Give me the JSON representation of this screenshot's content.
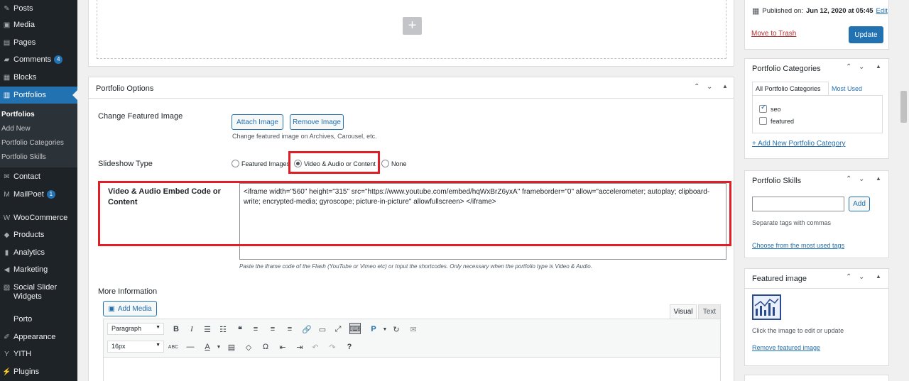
{
  "sidebar": {
    "items": [
      {
        "label": "Posts",
        "icon": "pin-icon"
      },
      {
        "label": "Media",
        "icon": "media-icon"
      },
      {
        "label": "Pages",
        "icon": "pages-icon"
      },
      {
        "label": "Comments",
        "icon": "comments-icon",
        "badge": "4"
      },
      {
        "label": "Blocks",
        "icon": "blocks-icon"
      },
      {
        "label": "Portfolios",
        "icon": "portfolio-icon"
      },
      {
        "label": "Contact",
        "icon": "mail-icon"
      },
      {
        "label": "MailPoet",
        "icon": "mailpoet-icon",
        "badge": "1"
      },
      {
        "label": "WooCommerce",
        "icon": "woo-icon"
      },
      {
        "label": "Products",
        "icon": "products-icon"
      },
      {
        "label": "Analytics",
        "icon": "analytics-icon"
      },
      {
        "label": "Marketing",
        "icon": "marketing-icon"
      },
      {
        "label": "Social Slider Widgets",
        "icon": "slider-icon"
      },
      {
        "label": "Porto",
        "icon": ""
      },
      {
        "label": "Appearance",
        "icon": "brush-icon"
      },
      {
        "label": "YITH",
        "icon": "yith-icon"
      },
      {
        "label": "Plugins",
        "icon": "plugin-icon"
      }
    ],
    "submenu": [
      "Portfolios",
      "Add New",
      "Portfolio Categories",
      "Portfolio Skills"
    ]
  },
  "portfolio_options": {
    "title": "Portfolio Options",
    "change_featured_label": "Change Featured Image",
    "attach_label": "Attach Image",
    "remove_label": "Remove Image",
    "featured_help": "Change featured image on Archives, Carousel, etc.",
    "slideshow_label": "Slideshow Type",
    "slideshow_options": [
      "Featured Images",
      "Video & Audio or Content",
      "None"
    ],
    "slideshow_selected": "Video & Audio or Content",
    "embed_label_1": "Video & Audio Embed Code or",
    "embed_label_2": "Content",
    "embed_value": "<iframe width=\"560\" height=\"315\" src=\"https://www.youtube.com/embed/hqWxBrZ6yxA\" frameborder=\"0\" allow=\"accelerometer; autoplay; clipboard-write; encrypted-media; gyroscope; picture-in-picture\" allowfullscreen> </iframe>",
    "embed_help": "Paste the iframe code of the Flash (YouTube or Vimeo etc) or Input the shortcodes. Only necessary when the portfolio type is Video & Audio.",
    "more_info_label": "More Information",
    "add_media_label": "Add Media",
    "tab_visual": "Visual",
    "tab_text": "Text",
    "format_select": "Paragraph",
    "size_select": "16px"
  },
  "publish": {
    "published_prefix": "Published on: ",
    "published_date": "Jun 12, 2020 at 05:45",
    "edit_label": "Edit",
    "trash_label": "Move to Trash",
    "update_label": "Update"
  },
  "categories": {
    "title": "Portfolio Categories",
    "tab_all": "All Portfolio Categories",
    "tab_most": "Most Used",
    "items": [
      {
        "label": "seo",
        "checked": true
      },
      {
        "label": "featured",
        "checked": false
      }
    ],
    "add_new": "+ Add New Portfolio Category"
  },
  "skills": {
    "title": "Portfolio Skills",
    "add_label": "Add",
    "help": "Separate tags with commas",
    "choose": "Choose from the most used tags"
  },
  "featured_image": {
    "title": "Featured image",
    "help": "Click the image to edit or update",
    "remove": "Remove featured image"
  },
  "colors": {
    "accent": "#2271b1",
    "highlight": "#e01e26",
    "sidebar": "#1d2327"
  }
}
